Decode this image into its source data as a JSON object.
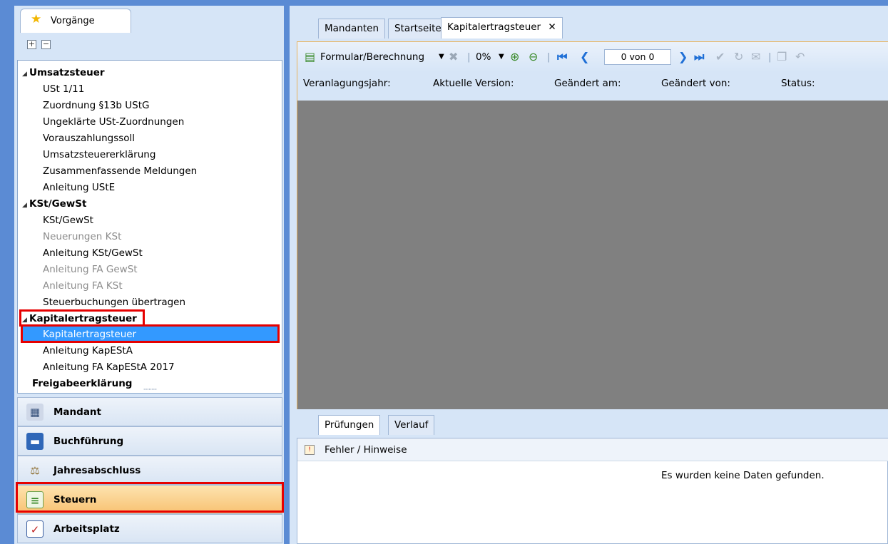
{
  "left_panel": {
    "tab_label": "Vorgänge",
    "tree": [
      {
        "type": "group",
        "label": "Umsatzsteuer",
        "expanded": true
      },
      {
        "type": "item",
        "label": "USt 1/11",
        "enabled": true
      },
      {
        "type": "item",
        "label": "Zuordnung §13b UStG",
        "enabled": true
      },
      {
        "type": "item",
        "label": "Ungeklärte USt-Zuordnungen",
        "enabled": true
      },
      {
        "type": "item",
        "label": "Vorauszahlungssoll",
        "enabled": true
      },
      {
        "type": "item",
        "label": "Umsatzsteuererklärung",
        "enabled": true
      },
      {
        "type": "item",
        "label": "Zusammenfassende Meldungen",
        "enabled": true
      },
      {
        "type": "item",
        "label": "Anleitung UStE",
        "enabled": true
      },
      {
        "type": "group",
        "label": "KSt/GewSt",
        "expanded": true
      },
      {
        "type": "item",
        "label": "KSt/GewSt",
        "enabled": true
      },
      {
        "type": "item",
        "label": "Neuerungen KSt",
        "enabled": false
      },
      {
        "type": "item",
        "label": "Anleitung KSt/GewSt",
        "enabled": true
      },
      {
        "type": "item",
        "label": "Anleitung FA GewSt",
        "enabled": false
      },
      {
        "type": "item",
        "label": "Anleitung FA KSt",
        "enabled": false
      },
      {
        "type": "item",
        "label": "Steuerbuchungen übertragen",
        "enabled": true
      },
      {
        "type": "group",
        "label": "Kapitalertragsteuer",
        "expanded": true
      },
      {
        "type": "item",
        "label": "Kapitalertragsteuer",
        "enabled": true,
        "selected": true
      },
      {
        "type": "item",
        "label": "Anleitung KapEStA",
        "enabled": true
      },
      {
        "type": "item",
        "label": "Anleitung FA KapEStA 2017",
        "enabled": true
      },
      {
        "type": "group",
        "label": "Freigabeerklärung",
        "expanded": false
      }
    ],
    "nav": [
      {
        "label": "Mandant",
        "icon": "building-icon",
        "active": false
      },
      {
        "label": "Buchführung",
        "icon": "book-icon",
        "active": false
      },
      {
        "label": "Jahresabschluss",
        "icon": "scales-icon",
        "active": false
      },
      {
        "label": "Steuern",
        "icon": "tax-form-icon",
        "active": true
      },
      {
        "label": "Arbeitsplatz",
        "icon": "checklist-icon",
        "active": false
      }
    ]
  },
  "tabs": [
    {
      "label": "Mandanten"
    },
    {
      "label": "Startseite"
    },
    {
      "label": "Kapitalertragsteuer",
      "active": true,
      "close": "✕"
    }
  ],
  "toolbar": {
    "form_label": "Formular/Berechnung",
    "zoom": "0%",
    "pager": "0 von 0"
  },
  "columns": [
    "Veranlagungsjahr:",
    "Aktuelle Version:",
    "Geändert am:",
    "Geändert von:",
    "Status:"
  ],
  "bottom": {
    "tabs": [
      {
        "label": "Prüfungen",
        "active": true
      },
      {
        "label": "Verlauf"
      }
    ],
    "header": "Fehler / Hinweise",
    "empty_message": "Es wurden keine Daten gefunden."
  },
  "colors": {
    "selection": "#3399ff",
    "highlight_red": "#e60000",
    "active_nav": "#f8c272",
    "content_grey": "#808080"
  }
}
